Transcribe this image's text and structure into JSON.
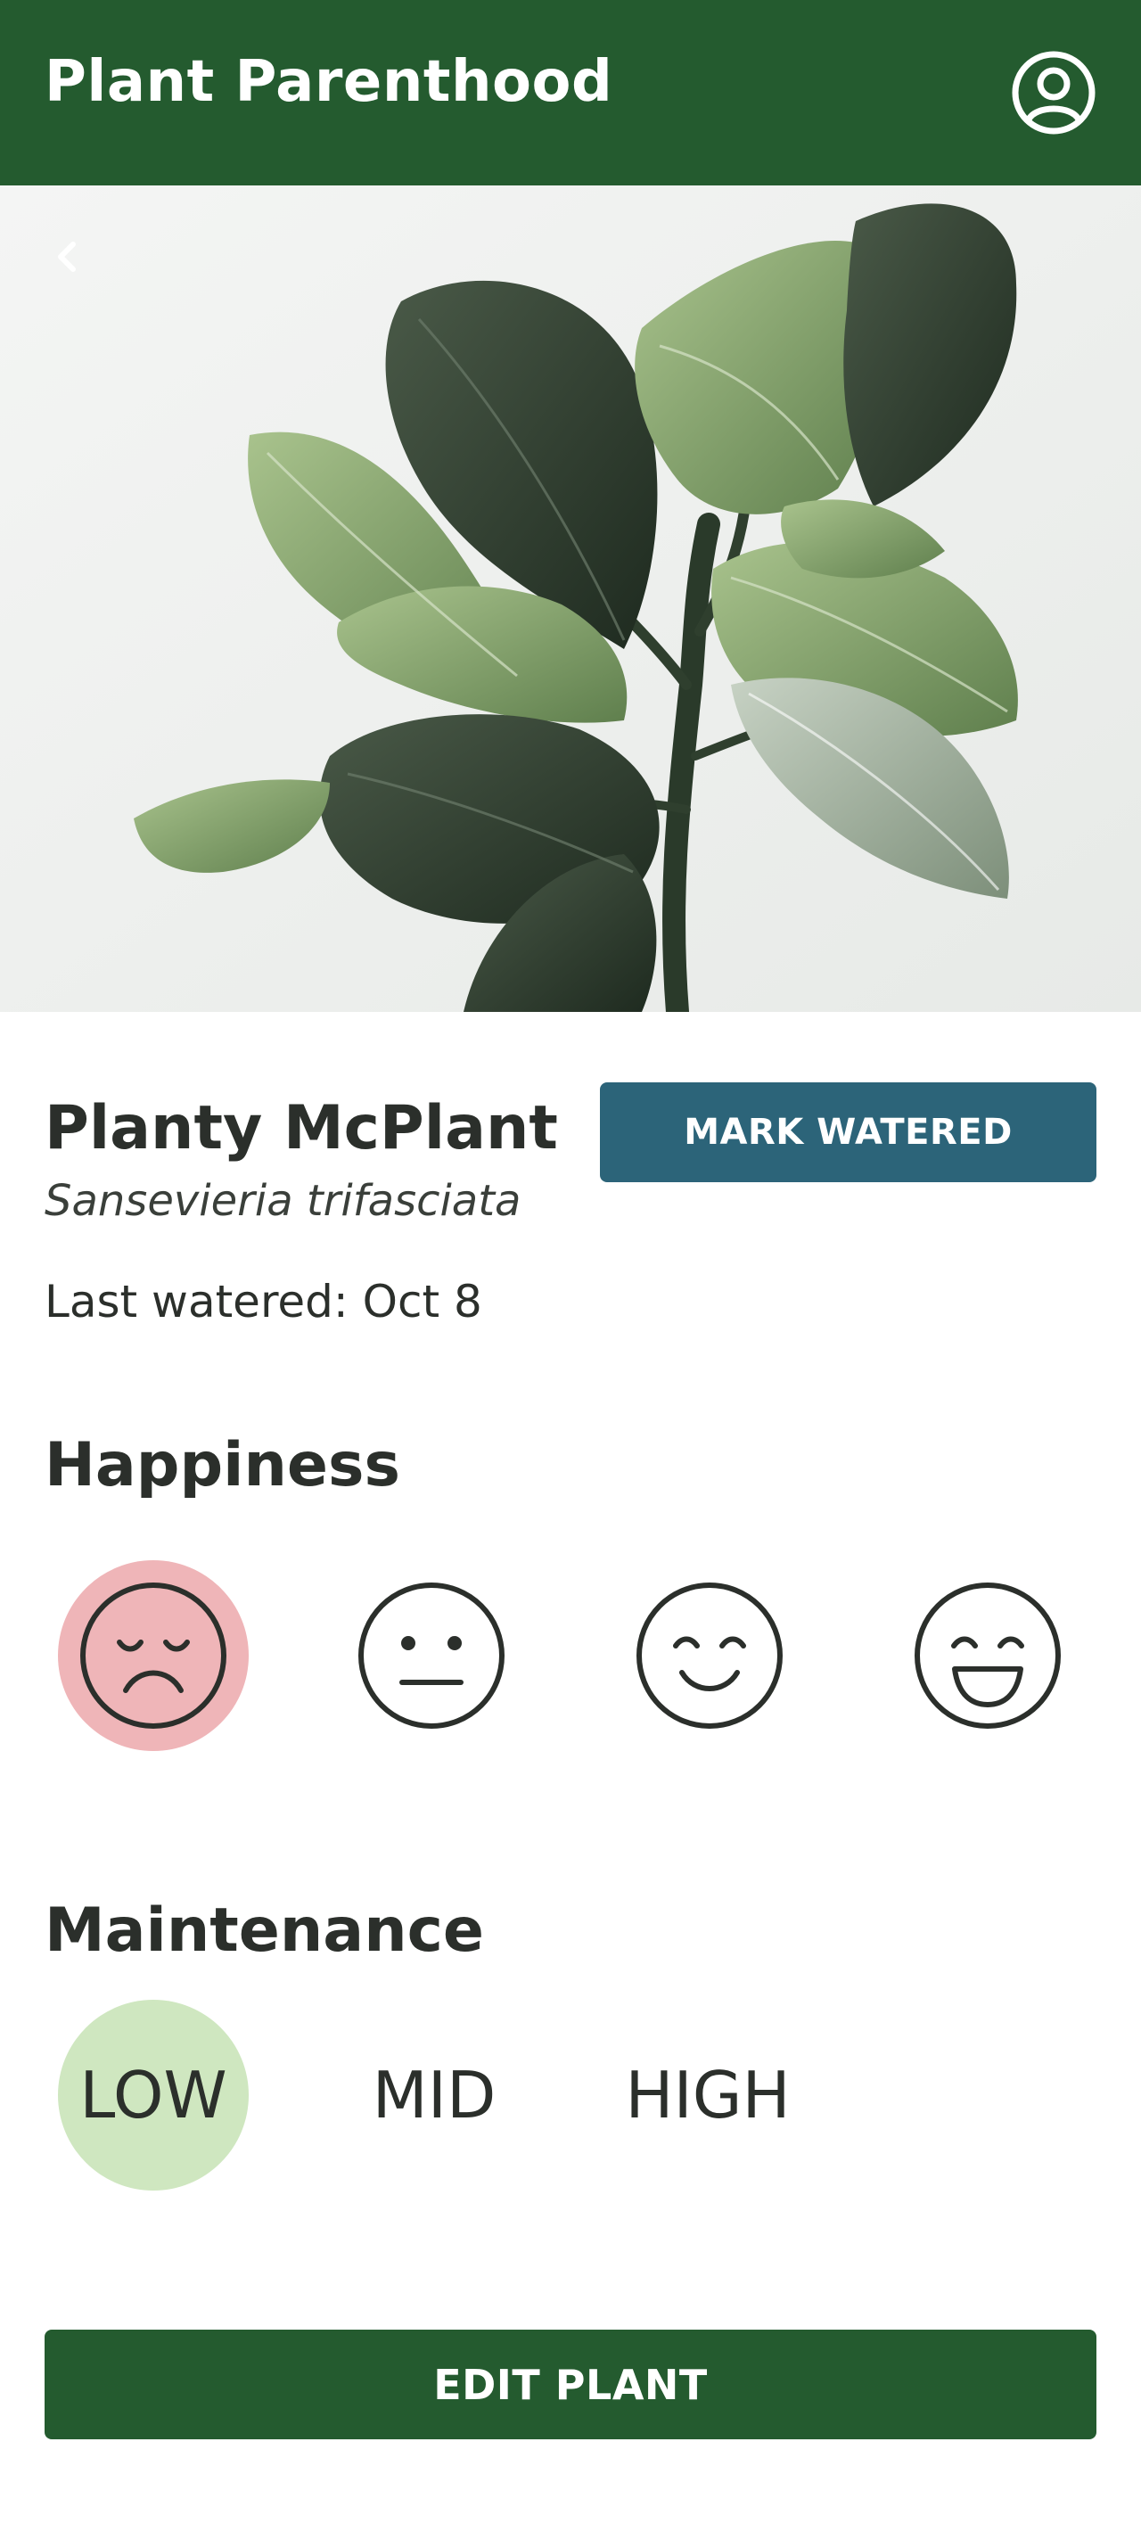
{
  "header": {
    "title": "Plant Parenthood",
    "profile_icon": "user-circle-icon"
  },
  "hero": {
    "back_icon": "chevron-left-icon"
  },
  "plant": {
    "name": "Planty McPlant",
    "species": "Sansevieria trifasciata",
    "last_watered": "Last watered: Oct 8",
    "mark_watered_label": "MARK WATERED"
  },
  "happiness": {
    "title": "Happiness",
    "selected": "sad",
    "options": [
      {
        "id": "sad",
        "icon": "sad-face-icon"
      },
      {
        "id": "neutral",
        "icon": "neutral-face-icon"
      },
      {
        "id": "smile",
        "icon": "smile-face-icon"
      },
      {
        "id": "grin",
        "icon": "grin-face-icon"
      }
    ],
    "selected_color": "#efb5b8"
  },
  "maintenance": {
    "title": "Maintenance",
    "selected": "LOW",
    "options": [
      "LOW",
      "MID",
      "HIGH"
    ],
    "selected_color": "#cfe7c0"
  },
  "footer": {
    "edit_label": "EDIT PLANT"
  },
  "colors": {
    "header": "#245b2f",
    "mark_watered_button": "#2c6479",
    "edit_button": "#245b2f",
    "text": "#2b2f2b"
  }
}
